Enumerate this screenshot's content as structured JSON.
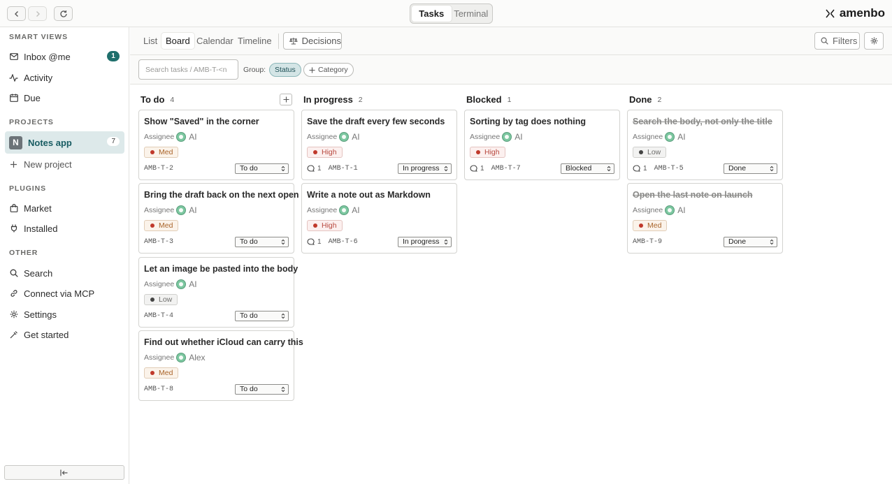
{
  "topbar": {
    "tabs": [
      "Tasks",
      "Terminal"
    ],
    "active_tab": "Tasks",
    "brand": "amenbo"
  },
  "sidebar": {
    "smart_views_label": "SMART VIEWS",
    "inbox": {
      "label": "Inbox @me",
      "count": "1"
    },
    "activity": "Activity",
    "due": "Due",
    "projects_label": "PROJECTS",
    "project": {
      "initial": "N",
      "name": "Notes app",
      "count": "7"
    },
    "new_project": "New project",
    "plugins_label": "PLUGINS",
    "market": "Market",
    "installed": "Installed",
    "other_label": "OTHER",
    "search": "Search",
    "mcp": "Connect via MCP",
    "settings": "Settings",
    "get_started": "Get started"
  },
  "viewbar": {
    "tabs": [
      "List",
      "Board",
      "Calendar",
      "Timeline"
    ],
    "active": "Board",
    "decisions": "Decisions",
    "filters": "Filters"
  },
  "filterbar": {
    "search_placeholder": "Search tasks / AMB-T-<n",
    "group_label": "Group:",
    "chips": [
      "Status",
      "Category"
    ]
  },
  "assignee_label": "Assignee",
  "columns": [
    {
      "title": "To do",
      "count": "4",
      "cards": [
        {
          "title": "Show \"Saved\" in the corner",
          "assignee": "AI",
          "priority": "Med",
          "id": "AMB-T-2",
          "status": "To do",
          "comments": ""
        },
        {
          "title": "Bring the draft back on the next open",
          "assignee": "AI",
          "priority": "Med",
          "id": "AMB-T-3",
          "status": "To do",
          "comments": ""
        },
        {
          "title": "Let an image be pasted into the body",
          "assignee": "AI",
          "priority": "Low",
          "id": "AMB-T-4",
          "status": "To do",
          "comments": ""
        },
        {
          "title": "Find out whether iCloud can carry this",
          "assignee": "Alex",
          "priority": "Med",
          "id": "AMB-T-8",
          "status": "To do",
          "comments": ""
        }
      ]
    },
    {
      "title": "In progress",
      "count": "2",
      "cards": [
        {
          "title": "Save the draft every few seconds",
          "assignee": "AI",
          "priority": "High",
          "id": "AMB-T-1",
          "status": "In progress",
          "comments": "1"
        },
        {
          "title": "Write a note out as Markdown",
          "assignee": "AI",
          "priority": "High",
          "id": "AMB-T-6",
          "status": "In progress",
          "comments": "1"
        }
      ]
    },
    {
      "title": "Blocked",
      "count": "1",
      "cards": [
        {
          "title": "Sorting by tag does nothing",
          "assignee": "AI",
          "priority": "High",
          "id": "AMB-T-7",
          "status": "Blocked",
          "comments": "1"
        }
      ]
    },
    {
      "title": "Done",
      "count": "2",
      "cards": [
        {
          "title": "Search the body, not only the title",
          "assignee": "AI",
          "priority": "Low",
          "id": "AMB-T-5",
          "status": "Done",
          "comments": "1"
        },
        {
          "title": "Open the last note on launch",
          "assignee": "AI",
          "priority": "Med",
          "id": "AMB-T-9",
          "status": "Done",
          "comments": ""
        }
      ]
    }
  ],
  "colors": {
    "accent": "#1f6f6c",
    "active_project_bg": "#dde9ea",
    "high": "#c0392b",
    "med": "#a9642a"
  }
}
